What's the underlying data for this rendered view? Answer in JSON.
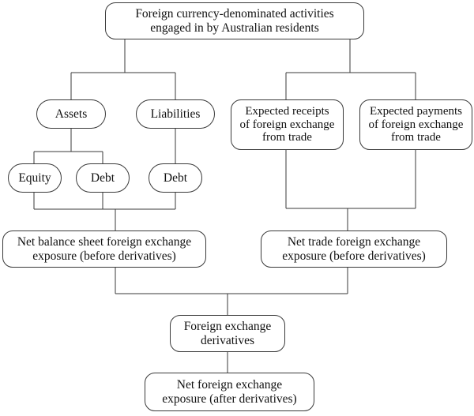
{
  "diagram": {
    "title": "Foreign currency-denominated activities engaged in by Australian residents",
    "type": "flowchart",
    "background_color": "#ffffff",
    "stroke_color": "#3a3a3a",
    "text_color": "#111111",
    "nodes": {
      "top": "Foreign currency-denominated activities\nengaged in by Australian residents",
      "assets": "Assets",
      "liabilities": "Liabilities",
      "expected_receipts": "Expected receipts\nof foreign exchange\nfrom trade",
      "expected_payments": "Expected payments\nof foreign exchange\nfrom trade",
      "equity": "Equity",
      "debt_assets": "Debt",
      "debt_liabilities": "Debt",
      "net_balance_sheet": "Net balance sheet foreign exchange\nexposure (before derivatives)",
      "net_trade": "Net trade foreign exchange\nexposure (before derivatives)",
      "fx_derivatives": "Foreign exchange\nderivatives",
      "net_fx_exposure": "Net foreign exchange\nexposure (after derivatives)"
    }
  }
}
